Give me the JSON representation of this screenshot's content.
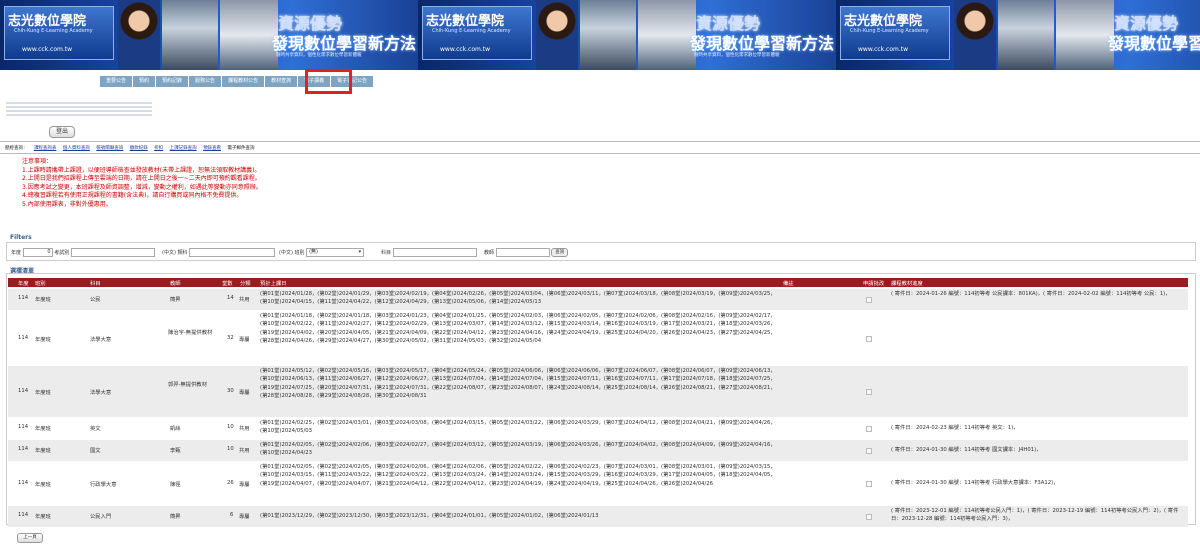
{
  "banner": {
    "logo_text": "志光數位學院",
    "logo_sub": "Chih-Kung E-Learning Academy",
    "logo_url": "www.cck.com.tw",
    "slogan_line1": "資源優勢",
    "slogan_line2": "發現數位學習新方法",
    "slogan_small": "隨時共享資料，個性化需求數位學習新體驗"
  },
  "nav": {
    "items": [
      "重要公告",
      "預約",
      "預約記錄",
      "服務公告",
      "課程教材公告",
      "教材查詢",
      "電子講義",
      "電子書記公告"
    ],
    "active": "教材查詢"
  },
  "logout_label": "登出",
  "subnav": {
    "prefix": "歷經查詢：",
    "items": [
      "課程查詢表",
      "個人資料查詢",
      "帳號關聯查詢",
      "繳款紀錄",
      "折扣",
      "上課記錄查詢",
      "預錄查看",
      "電子郵件查詢"
    ]
  },
  "notes": [
    "注意事項：",
    "1.上課時請攜帶上課證，以便班導師檢查並發放教材(未帶上課證，恕無法領取教材講義)。",
    "2.上開日是我們招課程上傳至雲端的日期，請在上開日之後一~二天內即可預約觀看課程。",
    "3.因應考試之變更，本班課程及師資調整，增減，變動之權利，如遇此等變動亦同意照辦。",
    "4.總複習課程若有使用正規課程的書籍(含法典)，請自行購買或同內格不免費提供。",
    "5.內部使用課表，非對外優惠用。"
  ],
  "filters": {
    "label": "Filters",
    "year_label": "年度",
    "year_value": "0",
    "examtype_label": "考試別",
    "examtype_value": "",
    "subject_label": "(中文) 類科",
    "subject_value": "",
    "cls_label": "(中文) 班別",
    "cls_value": "(無)",
    "subj2_label": "科目",
    "subj2_value": "",
    "teacher_label": "教師",
    "teacher_value": "",
    "query_button": "查詢"
  },
  "course_list": {
    "label": "選擇清單",
    "headers": {
      "year": "年度",
      "cls": "班別",
      "subject": "科目",
      "teacher": "教師",
      "hours": "堂數",
      "type": "分類",
      "dates": "預計上課日",
      "remark": "備註",
      "apply": "申請批改",
      "progress": "課程教材進度"
    },
    "rows": [
      {
        "year": "114",
        "cls": "年度班",
        "subject": "公民",
        "teacher": "簡昇",
        "hours": "14",
        "type": "共用",
        "dates": "(第01堂)2024/01/28，(第02堂)2024/01/29，(第03堂)2024/02/19，(第04堂)2024/02/26，(第05堂)2024/03/04，(第06堂)2024/03/11，(第07堂)2024/03/18，(第08堂)2024/03/19，(第09堂)2024/03/25，(第10堂)2024/04/15，(第11堂)2024/04/22，(第12堂)2024/04/29，(第13堂)2024/05/06，(第14堂)2024/05/13",
        "progress": "( 寄件日：2024-01-26 編號：114初等考 公民課本：801KA)，( 寄件日：2024-02-02 編號：114初等考 公民：1)，"
      },
      {
        "year": "114",
        "cls": "年度班",
        "subject": "法學大意",
        "teacher": "陳治宇-無提供教材",
        "hours": "32",
        "type": "專屬",
        "dates": "(第01堂)2024/01/18，(第02堂)2024/01/18，(第03堂)2024/01/23，(第04堂)2024/01/25，(第05堂)2024/02/03，(第06堂)2024/02/05，(第07堂)2024/02/06，(第08堂)2024/02/16，(第09堂)2024/02/17，(第10堂)2024/02/22，(第11堂)2024/02/27，(第12堂)2024/02/29，(第13堂)2024/03/07，(第14堂)2024/03/12，(第15堂)2024/03/14，(第16堂)2024/03/19，(第17堂)2024/03/21，(第18堂)2024/03/26，(第19堂)2024/04/02，(第20堂)2024/04/05，(第21堂)2024/04/09，(第22堂)2024/04/12，(第23堂)2024/04/16，(第24堂)2024/04/19，(第25堂)2024/04/20，(第26堂)2024/04/23，(第27堂)2024/04/25，(第28堂)2024/04/26，(第29堂)2024/04/27，(第30堂)2024/05/02，(第31堂)2024/05/03，(第32堂)2024/05/04",
        "progress": ""
      },
      {
        "year": "114",
        "cls": "年度班",
        "subject": "法學大意",
        "teacher": "郭羿-無提供教材",
        "hours": "30",
        "type": "專屬",
        "dates": "(第01堂)2024/05/12，(第02堂)2024/05/16，(第03堂)2024/05/17，(第04堂)2024/05/24，(第05堂)2024/06/06，(第06堂)2024/06/06，(第07堂)2024/06/07，(第08堂)2024/06/07，(第09堂)2024/06/13，(第10堂)2024/06/13，(第11堂)2024/06/27，(第12堂)2024/06/27，(第13堂)2024/07/04，(第14堂)2024/07/04，(第15堂)2024/07/11，(第16堂)2024/07/11，(第17堂)2024/07/18，(第18堂)2024/07/25，(第19堂)2024/07/25，(第20堂)2024/07/31，(第21堂)2024/07/31，(第22堂)2024/08/07，(第23堂)2024/08/07，(第24堂)2024/08/14，(第25堂)2024/08/14，(第26堂)2024/08/21，(第27堂)2024/08/21，(第28堂)2024/08/28，(第29堂)2024/08/28，(第30堂)2024/08/31",
        "progress": ""
      },
      {
        "year": "114",
        "cls": "年度班",
        "subject": "英文",
        "teacher": "凱絲",
        "hours": "10",
        "type": "共用",
        "dates": "(第01堂)2024/02/25，(第02堂)2024/03/01，(第03堂)2024/03/08，(第04堂)2024/03/15，(第05堂)2024/03/22，(第06堂)2024/03/29，(第07堂)2024/04/12，(第08堂)2024/04/21，(第09堂)2024/04/26，(第10堂)2024/05/03",
        "progress": "( 寄件日：2024-02-23 編號：114初等考 英文：1)，"
      },
      {
        "year": "114",
        "cls": "年度班",
        "subject": "國文",
        "teacher": "李甄",
        "hours": "10",
        "type": "共用",
        "dates": "(第01堂)2024/02/05，(第02堂)2024/02/06，(第03堂)2024/02/27，(第04堂)2024/03/12，(第05堂)2024/03/19，(第06堂)2024/03/26，(第07堂)2024/04/02，(第08堂)2024/04/09，(第09堂)2024/04/16，(第10堂)2024/04/23",
        "progress": "( 寄件日：2024-01-30 編號：114初等考 國文課本：J4H01)，"
      },
      {
        "year": "114",
        "cls": "年度班",
        "subject": "行政學大意",
        "teacher": "陳徑",
        "hours": "26",
        "type": "專屬",
        "dates": "(第01堂)2024/02/05，(第02堂)2024/02/05，(第03堂)2024/02/06，(第04堂)2024/02/06，(第05堂)2024/02/22，(第06堂)2024/02/23，(第07堂)2024/03/01，(第08堂)2024/03/01，(第09堂)2024/03/15，(第10堂)2024/03/15，(第11堂)2024/03/22，(第12堂)2024/03/22，(第13堂)2024/03/24，(第14堂)2024/03/24，(第15堂)2024/03/29，(第16堂)2024/03/29，(第17堂)2024/04/05，(第18堂)2024/04/05，(第19堂)2024/04/07，(第20堂)2024/04/07，(第21堂)2024/04/12，(第22堂)2024/04/12，(第23堂)2024/04/19，(第24堂)2024/04/19，(第25堂)2024/04/26，(第26堂)2024/04/26",
        "progress": "( 寄件日：2024-01-30 編號：114初等考 行政學大意課本：F3A12)，"
      },
      {
        "year": "114",
        "cls": "年度班",
        "subject": "公民入門",
        "teacher": "簡昇",
        "hours": "6",
        "type": "專屬",
        "dates": "(第01堂)2023/12/29，(第02堂)2023/12/30，(第03堂)2023/12/31，(第04堂)2024/01/01，(第05堂)2024/01/02，(第06堂)2024/01/13",
        "progress": "( 寄件日：2023-12-01 編號：114初等考公民入門：1)，( 寄件日：2023-12-19 編號：114初等考公民入門：2)，( 寄件日：2023-12-28 編號：114初等考公民入門：3)，"
      }
    ]
  },
  "prev_button": "上一頁",
  "colors": {
    "header_bg": "#9b1b1f",
    "nav_bg": "#7ea4c4",
    "highlight_box": "#e0211c",
    "notes_text": "#cc0000"
  }
}
